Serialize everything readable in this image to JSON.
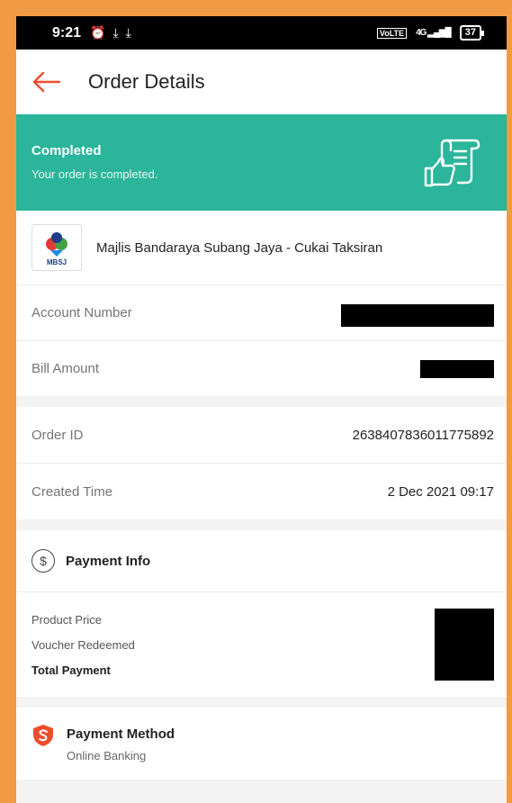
{
  "status_bar": {
    "time": "9:21",
    "icons": [
      "alarm-icon",
      "download-icon",
      "download-icon"
    ],
    "network": "4G",
    "battery": "37"
  },
  "header": {
    "title": "Order Details",
    "back_icon": "arrow-left-icon"
  },
  "banner": {
    "status": "Completed",
    "message": "Your order is completed.",
    "icon": "receipt-thumbs-up-icon",
    "color": "#2bb59b"
  },
  "merchant": {
    "logo_text": "MBSJ",
    "name": "Majlis Bandaraya Subang Jaya - Cukai Taksiran"
  },
  "details": {
    "account_number_label": "Account Number",
    "bill_amount_label": "Bill Amount",
    "order_id_label": "Order ID",
    "order_id_value": "2638407836011775892",
    "created_time_label": "Created Time",
    "created_time_value": "2 Dec 2021 09:17"
  },
  "payment_info": {
    "title": "Payment Info",
    "icon": "dollar-circle-icon",
    "product_price_label": "Product Price",
    "voucher_label": "Voucher Redeemed",
    "total_label": "Total Payment"
  },
  "payment_method": {
    "title": "Payment Method",
    "icon": "shield-s-icon",
    "value": "Online Banking"
  },
  "accent": "#ee4d2d"
}
